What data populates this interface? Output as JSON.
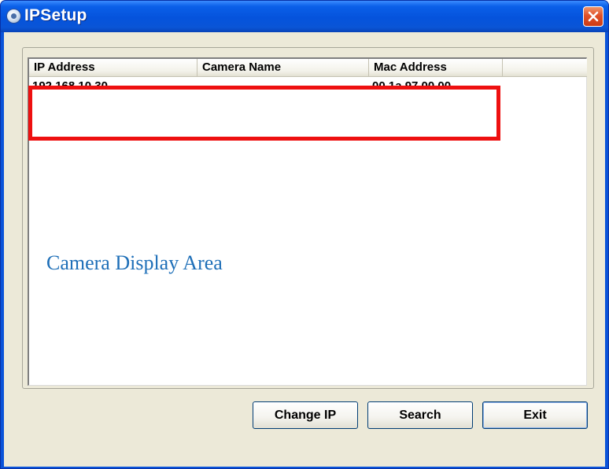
{
  "window": {
    "title": "IPSetup",
    "app_icon": "ipsetup-app-icon",
    "close_icon": "close-icon"
  },
  "camera_list": {
    "columns": [
      "IP Address",
      "Camera Name",
      "Mac Address"
    ],
    "rows": [
      {
        "ip_address": "192.168.10.30",
        "camera_name": "",
        "mac_address": "00 1a 97 00 00..."
      }
    ]
  },
  "annotation": {
    "area_label": "Camera Display Area",
    "highlight_color": "#ee1010",
    "label_color": "#1e6fb8"
  },
  "buttons": {
    "change_ip": "Change IP",
    "search": "Search",
    "exit": "Exit"
  },
  "colors": {
    "titlebar": "#0553dc",
    "dialog_face": "#ece9d8",
    "close_button": "#e0512a"
  }
}
